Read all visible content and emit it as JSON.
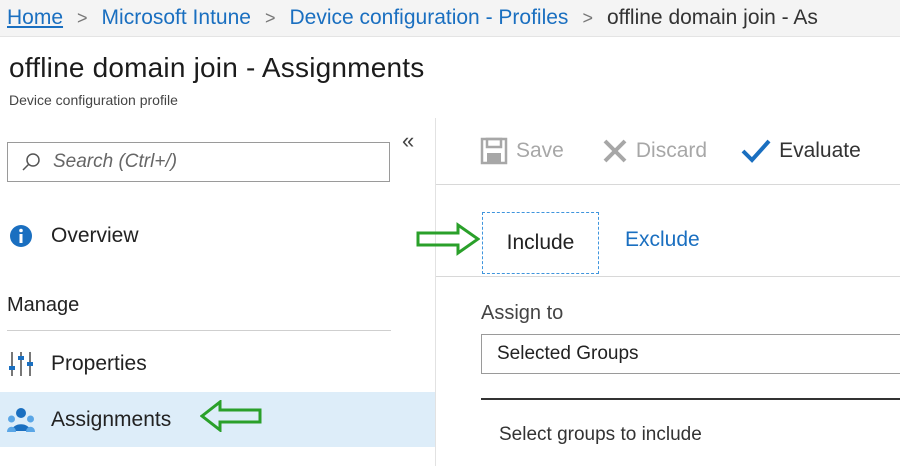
{
  "breadcrumb": {
    "items": [
      "Home",
      "Microsoft Intune",
      "Device configuration - Profiles"
    ],
    "current": "offline domain join - As"
  },
  "page": {
    "title": "offline domain join - Assignments",
    "subtitle": "Device configuration profile"
  },
  "search": {
    "placeholder": "Search (Ctrl+/)"
  },
  "nav": {
    "overview": "Overview",
    "manage_section": "Manage",
    "properties": "Properties",
    "assignments": "Assignments",
    "active": "assignments"
  },
  "toolbar": {
    "save": "Save",
    "discard": "Discard",
    "evaluate": "Evaluate"
  },
  "tabs": {
    "include": "Include",
    "exclude": "Exclude",
    "selected": "include"
  },
  "assign": {
    "label": "Assign to",
    "value": "Selected Groups",
    "select_groups_text": "Select groups to include"
  },
  "colors": {
    "link": "#1a6fc0",
    "active_nav_bg": "#ddedf9",
    "annotation_arrow": "#2aa02a",
    "evaluate_check": "#1a6fc0"
  },
  "annotations": [
    "green-arrow-icon",
    "green-arrow-icon"
  ]
}
